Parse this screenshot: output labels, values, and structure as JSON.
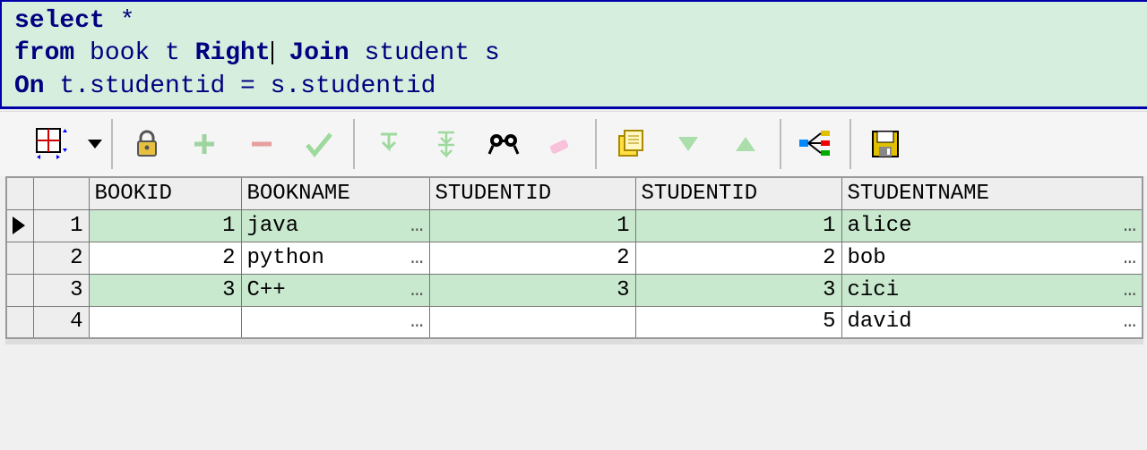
{
  "sql": {
    "kw_select": "select",
    "star": " *",
    "kw_from": "from",
    "tbl1": " book t ",
    "kw_right": "Right",
    "kw_join": " Join",
    "tbl2": " student s",
    "kw_on": "On",
    "cond": " t.studentid = s.studentid"
  },
  "columns": {
    "bookid": "BOOKID",
    "bookname": "BOOKNAME",
    "studentid1": "STUDENTID",
    "studentid2": "STUDENTID",
    "studentname": "STUDENTNAME"
  },
  "rows": [
    {
      "n": "1",
      "bookid": "1",
      "bookname": "java",
      "sid1": "1",
      "sid2": "1",
      "sname": "alice",
      "marker": "▶"
    },
    {
      "n": "2",
      "bookid": "2",
      "bookname": "python",
      "sid1": "2",
      "sid2": "2",
      "sname": "bob",
      "marker": ""
    },
    {
      "n": "3",
      "bookid": "3",
      "bookname": "C++",
      "sid1": "3",
      "sid2": "3",
      "sname": "cici",
      "marker": ""
    },
    {
      "n": "4",
      "bookid": "",
      "bookname": "",
      "sid1": "",
      "sid2": "5",
      "sname": "david",
      "marker": ""
    }
  ],
  "ellipsis": "…"
}
